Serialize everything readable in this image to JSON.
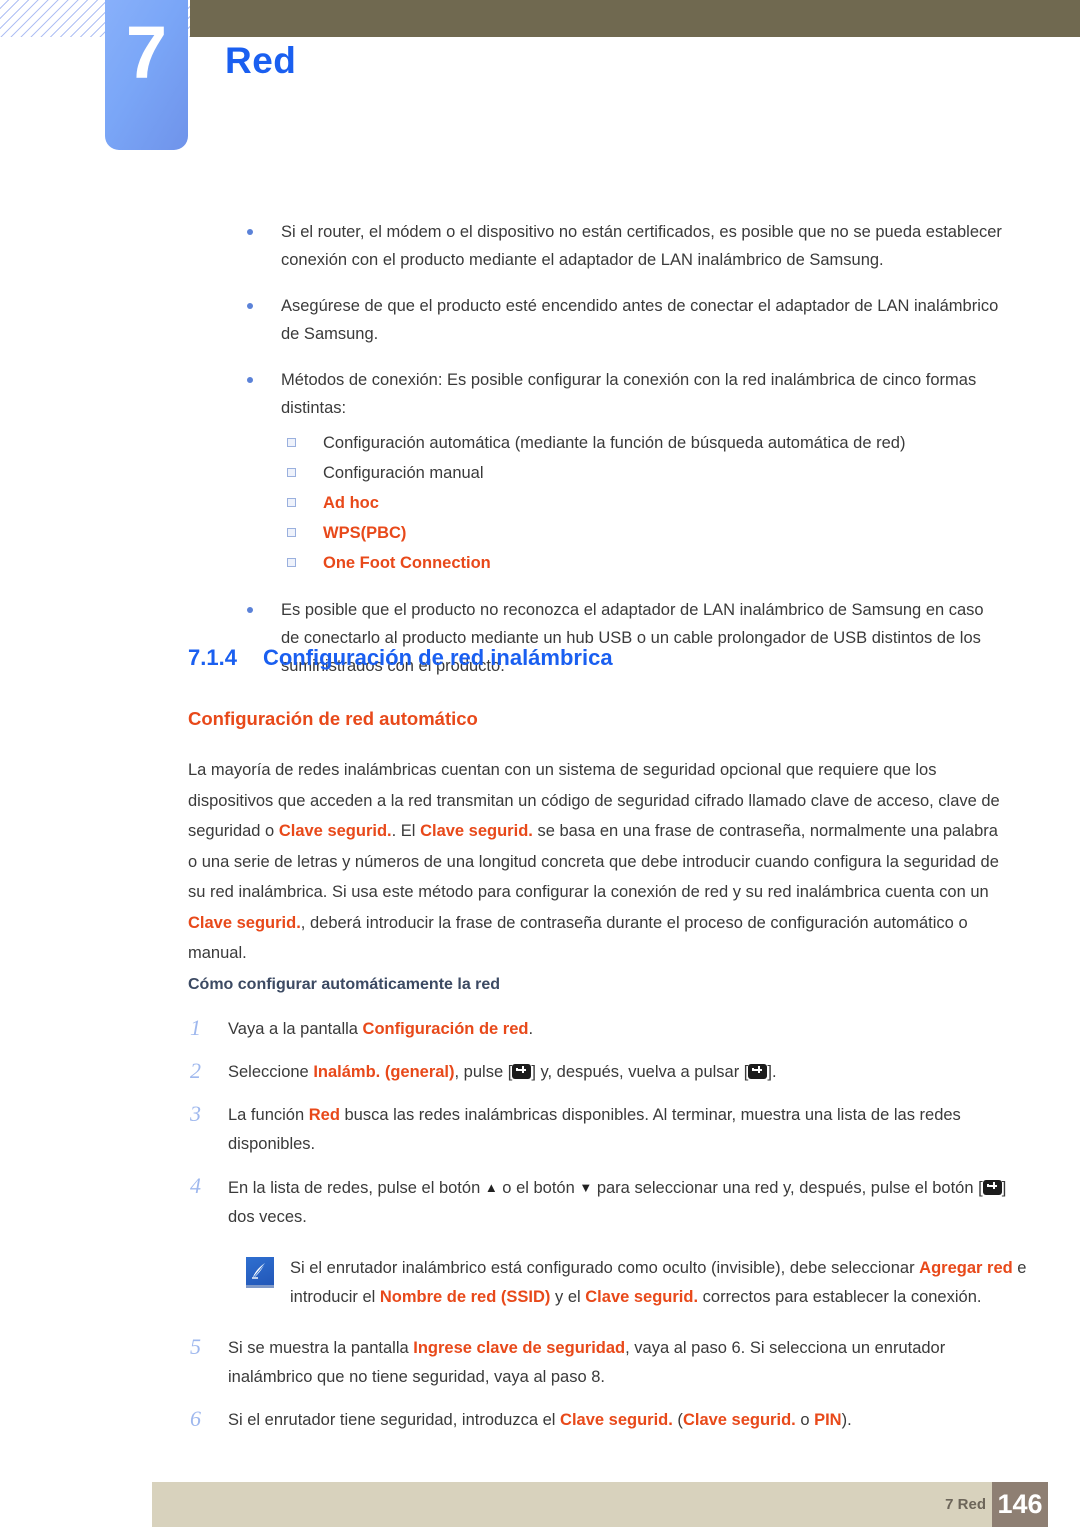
{
  "header": {
    "chapter_number": "7",
    "chapter_title": "Red",
    "colors": {
      "tab_blue": "#7aa6f7",
      "olive_bar": "#706950",
      "title_blue": "#1a5ff0"
    }
  },
  "bullets": [
    {
      "text": "Si el router, el módem o el dispositivo no están certificados, es posible que no se pueda establecer conexión con el producto mediante el adaptador de LAN inalámbrico de Samsung."
    },
    {
      "text": "Asegúrese de que el producto esté encendido antes de conectar el adaptador de LAN inalámbrico de Samsung."
    },
    {
      "text": "Métodos de conexión: Es posible configurar la conexión con la red inalámbrica de cinco formas distintas:",
      "subitems": [
        {
          "text": "Configuración automática (mediante la función de búsqueda automática de red)",
          "highlight": false
        },
        {
          "text": "Configuración manual",
          "highlight": false
        },
        {
          "text": "Ad hoc",
          "highlight": true
        },
        {
          "text": "WPS(PBC)",
          "highlight": true
        },
        {
          "text": "One Foot Connection",
          "highlight": true
        }
      ]
    },
    {
      "text": "Es posible que el producto no reconozca el adaptador de LAN inalámbrico de Samsung en caso de conectarlo al producto mediante un hub USB o un cable prolongador de USB distintos de los suministrados con el producto."
    }
  ],
  "section": {
    "number": "7.1.4",
    "title": "Configuración de red inalámbrica",
    "subtitle": "Configuración de red automático"
  },
  "paragraph": {
    "p1": "La mayoría de redes inalámbricas cuentan con un sistema de seguridad opcional que requiere que los dispositivos que acceden a la red transmitan un código de seguridad cifrado llamado clave de acceso, clave de seguridad o ",
    "term1": "Clave segurid.",
    "p2": ". El ",
    "term2": "Clave segurid.",
    "p3": " se basa en una frase de contraseña, normalmente una palabra o una serie de letras y números de una longitud concreta que debe introducir cuando configura la seguridad de su red inalámbrica. Si usa este método para configurar la conexión de red y su red inalámbrica cuenta con un ",
    "term3": "Clave segurid.",
    "p4": ", deberá introducir la frase de contraseña durante el proceso de configuración automático o manual."
  },
  "howto_heading": "Cómo configurar automáticamente la red",
  "steps": [
    {
      "num": "1",
      "parts": [
        {
          "t": "Vaya a la pantalla ",
          "style": "plain"
        },
        {
          "t": "Configuración de red",
          "style": "orange"
        },
        {
          "t": ".",
          "style": "plain"
        }
      ]
    },
    {
      "num": "2",
      "parts": [
        {
          "t": "Seleccione ",
          "style": "plain"
        },
        {
          "t": "Inalámb. (general)",
          "style": "orange"
        },
        {
          "t": ", pulse [",
          "style": "plain"
        },
        {
          "t": "enter-key-icon",
          "style": "keyicon"
        },
        {
          "t": "] y, después, vuelva a pulsar [",
          "style": "plain"
        },
        {
          "t": "enter-key-icon",
          "style": "keyicon"
        },
        {
          "t": "].",
          "style": "plain"
        }
      ]
    },
    {
      "num": "3",
      "parts": [
        {
          "t": "La función ",
          "style": "plain"
        },
        {
          "t": "Red",
          "style": "orange"
        },
        {
          "t": " busca las redes inalámbricas disponibles. Al terminar, muestra una lista de las redes disponibles.",
          "style": "plain"
        }
      ]
    },
    {
      "num": "4",
      "parts": [
        {
          "t": "En la lista de redes, pulse el botón ",
          "style": "plain"
        },
        {
          "t": "arrow-up-icon",
          "style": "arrowup"
        },
        {
          "t": " o el botón ",
          "style": "plain"
        },
        {
          "t": "arrow-down-icon",
          "style": "arrowdown"
        },
        {
          "t": " para seleccionar una red y, después, pulse el botón [",
          "style": "plain"
        },
        {
          "t": "enter-key-icon",
          "style": "keyicon"
        },
        {
          "t": "] dos veces.",
          "style": "plain"
        }
      ]
    },
    {
      "num": "5",
      "parts": [
        {
          "t": "Si se muestra la pantalla ",
          "style": "plain"
        },
        {
          "t": "Ingrese clave de seguridad",
          "style": "orange"
        },
        {
          "t": ", vaya al paso 6. Si selecciona un enrutador inalámbrico que no tiene seguridad, vaya al paso 8.",
          "style": "plain"
        }
      ]
    },
    {
      "num": "6",
      "parts": [
        {
          "t": "Si el enrutador tiene seguridad, introduzca el ",
          "style": "plain"
        },
        {
          "t": "Clave segurid.",
          "style": "orange"
        },
        {
          "t": " (",
          "style": "plain"
        },
        {
          "t": "Clave segurid.",
          "style": "orange"
        },
        {
          "t": " o ",
          "style": "plain"
        },
        {
          "t": "PIN",
          "style": "orange"
        },
        {
          "t": ").",
          "style": "plain"
        }
      ]
    }
  ],
  "note": {
    "icon": "note-pencil-icon",
    "parts": [
      {
        "t": "Si el enrutador inalámbrico está configurado como oculto (invisible), debe seleccionar ",
        "style": "plain"
      },
      {
        "t": "Agregar red",
        "style": "orange"
      },
      {
        "t": " e introducir el ",
        "style": "plain"
      },
      {
        "t": "Nombre de red (SSID)",
        "style": "orange"
      },
      {
        "t": " y el ",
        "style": "plain"
      },
      {
        "t": "Clave segurid.",
        "style": "orange"
      },
      {
        "t": " correctos para establecer la conexión.",
        "style": "plain"
      }
    ]
  },
  "footer": {
    "label": "7 Red",
    "page": "146",
    "bar_color": "#d8d2bd",
    "page_box_color": "#8e7f73"
  }
}
